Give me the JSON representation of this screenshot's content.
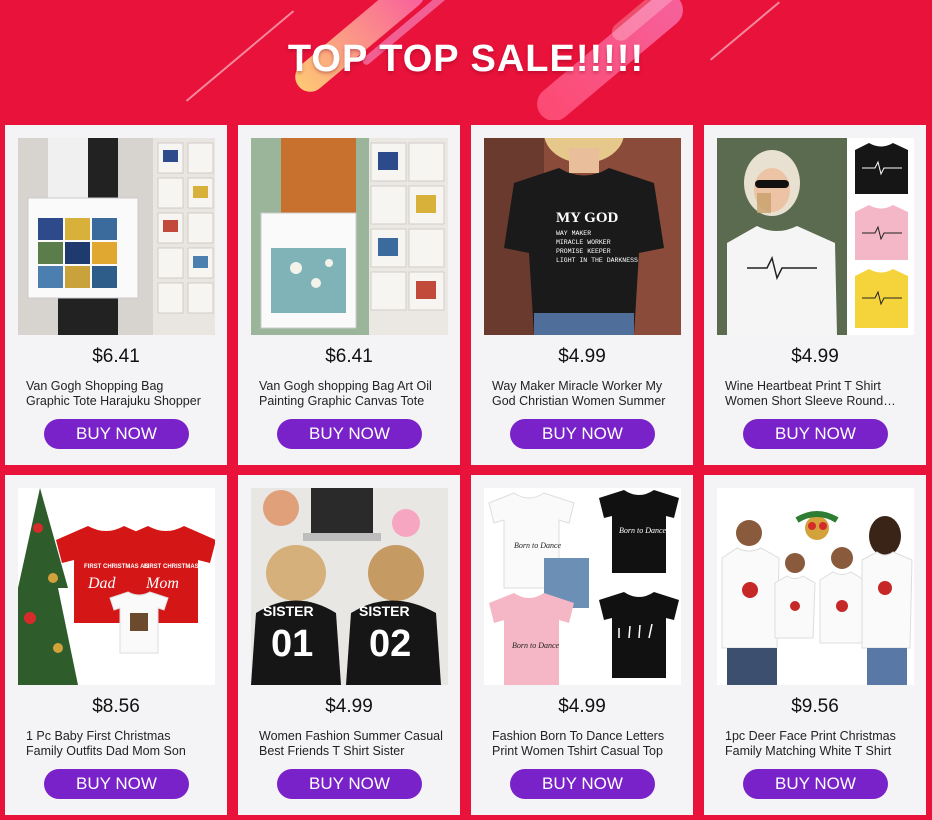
{
  "banner": {
    "title": "TOP TOP SALE!!!!!"
  },
  "products": [
    {
      "price": "$6.41",
      "name": "Van Gogh Shopping Bag Graphic Tote Harajuku Shopper",
      "button": "BUY NOW",
      "image_icon": "tote-bag-icon"
    },
    {
      "price": "$6.41",
      "name": "Van Gogh shopping Bag Art Oil Painting Graphic Canvas Tote",
      "button": "BUY NOW",
      "image_icon": "tote-bag-icon"
    },
    {
      "price": "$4.99",
      "name": "Way Maker Miracle Worker My God Christian Women Summer",
      "button": "BUY NOW",
      "image_icon": "tshirt-icon",
      "shirt_text": [
        "MY GOD",
        "WAY MAKER",
        "MIRACLE WORKER",
        "PROMISE KEEPER",
        "LIGHT IN THE DARKNESS"
      ]
    },
    {
      "price": "$4.99",
      "name": "Wine Heartbeat Print T Shirt Women Short Sleeve Round Neck",
      "button": "BUY NOW",
      "image_icon": "tshirt-icon"
    },
    {
      "price": "$8.56",
      "name": "1 Pc Baby First Christmas Family Outfits Dad Mom Son",
      "button": "BUY NOW",
      "image_icon": "tshirt-icon",
      "shirt_text": [
        "FIRST CHRISTMAS AS",
        "Dad",
        "FIRST CHRISTMAS AS",
        "Mom"
      ]
    },
    {
      "price": "$4.99",
      "name": "Women Fashion Summer Casual Best Friends T Shirt Sister",
      "button": "BUY NOW",
      "image_icon": "tshirt-icon",
      "shirt_text": [
        "SISTER",
        "01",
        "SISTER",
        "02"
      ]
    },
    {
      "price": "$4.99",
      "name": "Fashion Born To Dance Letters Print Women Tshirt Casual Top",
      "button": "BUY NOW",
      "image_icon": "tshirt-icon",
      "shirt_text": [
        "Born to Dance"
      ]
    },
    {
      "price": "$9.56",
      "name": "1pc Deer Face Print Christmas Family Matching White T Shirt",
      "button": "BUY NOW",
      "image_icon": "tshirt-icon"
    }
  ],
  "colors": {
    "background": "#e8123a",
    "button": "#7a22c9",
    "card": "#f4f4f6"
  }
}
